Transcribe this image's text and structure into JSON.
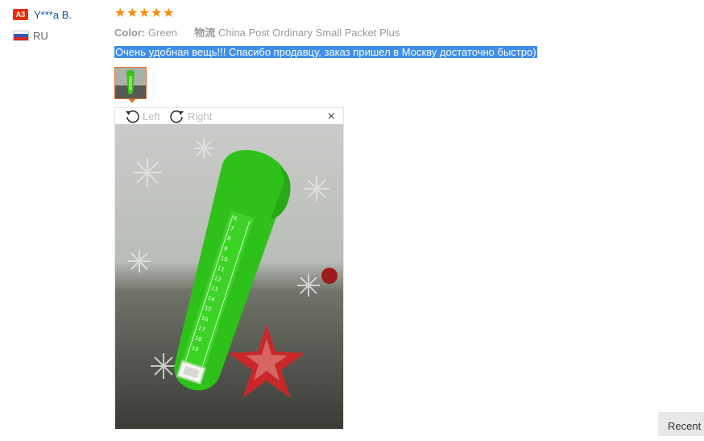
{
  "user": {
    "level_badge": "A3",
    "name": "Y***a B.",
    "country": "RU"
  },
  "review": {
    "rating": 5,
    "stars": [
      "★",
      "★",
      "★",
      "★",
      "★"
    ],
    "color_label": "Color:",
    "color_value": "Green",
    "shipping_label": "物流",
    "shipping_value": "China Post Ordinary Small Packet Plus",
    "feedback_text": "Очень удобная вещь!!! Спасибо продавцу, заказ пришел в Москву достаточно быстро)"
  },
  "viewer": {
    "rotate_left_label": "Left",
    "rotate_right_label": "Right",
    "close_glyph": "×",
    "rotate_left_icon": "rotate-left-icon",
    "rotate_right_icon": "rotate-right-icon"
  },
  "photo": {
    "ruler_numbers": [
      "6",
      "7",
      "8",
      "9",
      "10",
      "11",
      "12",
      "13",
      "14",
      "15",
      "16",
      "17",
      "18",
      "19"
    ]
  },
  "footer": {
    "recent_label": "Recent"
  },
  "colors": {
    "star": "#f98d0b",
    "link": "#0a53a8",
    "highlight": "#3f8ee8",
    "thumb_border": "#e56f2a",
    "badge": "#e62e04"
  }
}
